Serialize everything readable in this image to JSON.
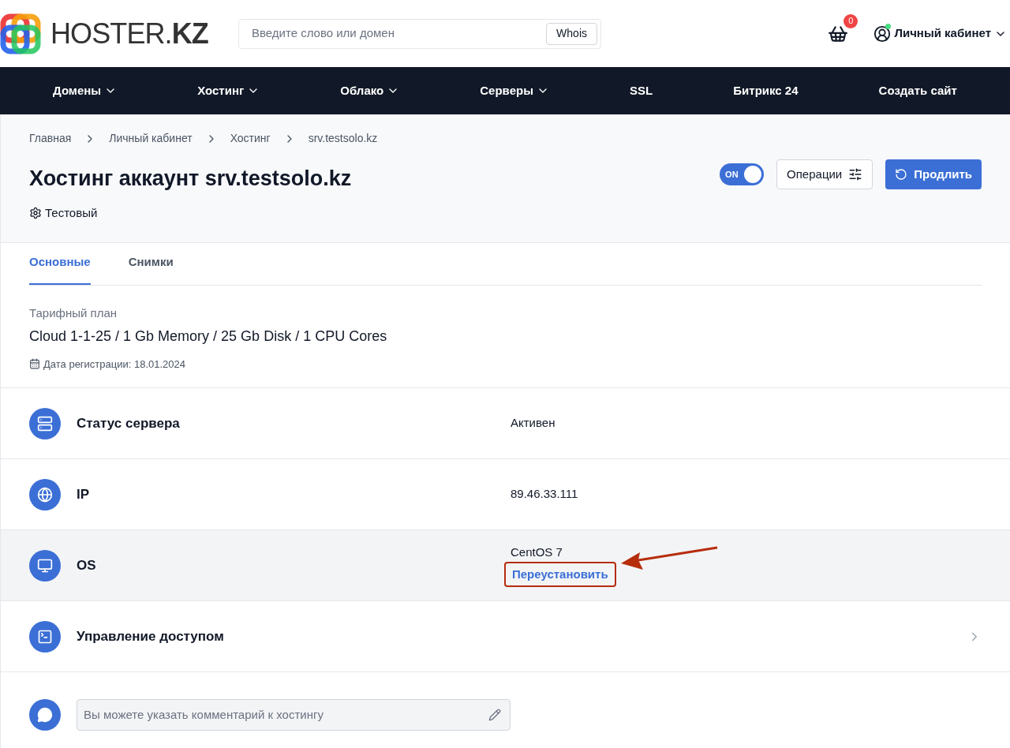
{
  "header": {
    "logo": {
      "name": "HOSTER.",
      "suffix": "KZ"
    },
    "search": {
      "placeholder": "Введите слово или домен",
      "button": "Whois"
    },
    "cart": {
      "count": "0"
    },
    "account": {
      "label": "Личный кабинет",
      "online": true
    }
  },
  "nav": [
    {
      "label": "Домены",
      "dropdown": true
    },
    {
      "label": "Хостинг",
      "dropdown": true
    },
    {
      "label": "Облако",
      "dropdown": true
    },
    {
      "label": "Серверы",
      "dropdown": true
    },
    {
      "label": "SSL",
      "dropdown": false
    },
    {
      "label": "Битрикс 24",
      "dropdown": false
    },
    {
      "label": "Создать сайт",
      "dropdown": false
    }
  ],
  "breadcrumbs": [
    "Главная",
    "Личный кабинет",
    "Хостинг",
    "srv.testsolo.kz"
  ],
  "title": "Хостинг аккаунт srv.testsolo.kz",
  "tag": "Тестовый",
  "toggle": {
    "label": "ON",
    "on": true
  },
  "operations_button": "Операции",
  "renew_button": "Продлить",
  "tabs": [
    {
      "label": "Основные",
      "selected": true
    },
    {
      "label": "Снимки",
      "selected": false
    }
  ],
  "plan": {
    "label": "Тарифный план",
    "value": "Cloud 1-1-25 / 1 Gb Memory / 25 Gb Disk / 1 CPU Cores",
    "registered": "Дата регистрации: 18.01.2024"
  },
  "rows": [
    {
      "kind": "status",
      "label": "Статус сервера",
      "value": "Активен",
      "shaded": false
    },
    {
      "kind": "ip",
      "label": "IP",
      "value": "89.46.33.111",
      "shaded": false
    },
    {
      "kind": "os",
      "label": "OS",
      "value": "CentOS 7",
      "action": "Переустановить",
      "highlighted": true,
      "shaded": true
    },
    {
      "kind": "access",
      "label": "Управление доступом",
      "shaded": false
    }
  ],
  "comment": {
    "placeholder": "Вы можете указать комментарий к хостингу"
  }
}
